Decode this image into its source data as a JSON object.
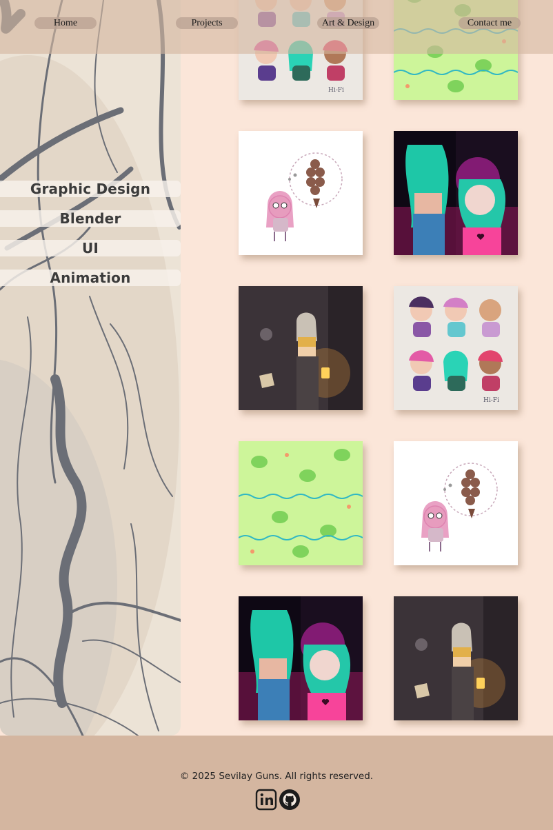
{
  "nav": {
    "home": "Home",
    "projects": "Projects",
    "art_design": "Art & Design",
    "contact": "Contact me"
  },
  "categories": [
    "Graphic Design",
    "Blender",
    "UI",
    "Animation"
  ],
  "gallery": [
    {
      "artwork": "hi-fi-chibi-characters"
    },
    {
      "artwork": "frog-pond-pattern"
    },
    {
      "artwork": "girl-dreaming-of-ice-cream"
    },
    {
      "artwork": "two-girls-neon-night"
    },
    {
      "artwork": "girl-with-lantern-dark-alley"
    },
    {
      "artwork": "hi-fi-chibi-characters"
    },
    {
      "artwork": "frog-pond-pattern"
    },
    {
      "artwork": "girl-dreaming-of-ice-cream"
    },
    {
      "artwork": "two-girls-neon-night"
    },
    {
      "artwork": "girl-with-lantern-dark-alley"
    }
  ],
  "footer": {
    "copyright": "© 2025 Sevilay Guns. All rights reserved.",
    "icons": [
      "linkedin-icon",
      "github-icon"
    ]
  },
  "colors": {
    "page_bg": "#fbe6d9",
    "nav_bg": "#d4b6a0",
    "footer_bg": "#d4b6a0",
    "panel_bg": "#ece3d6"
  }
}
